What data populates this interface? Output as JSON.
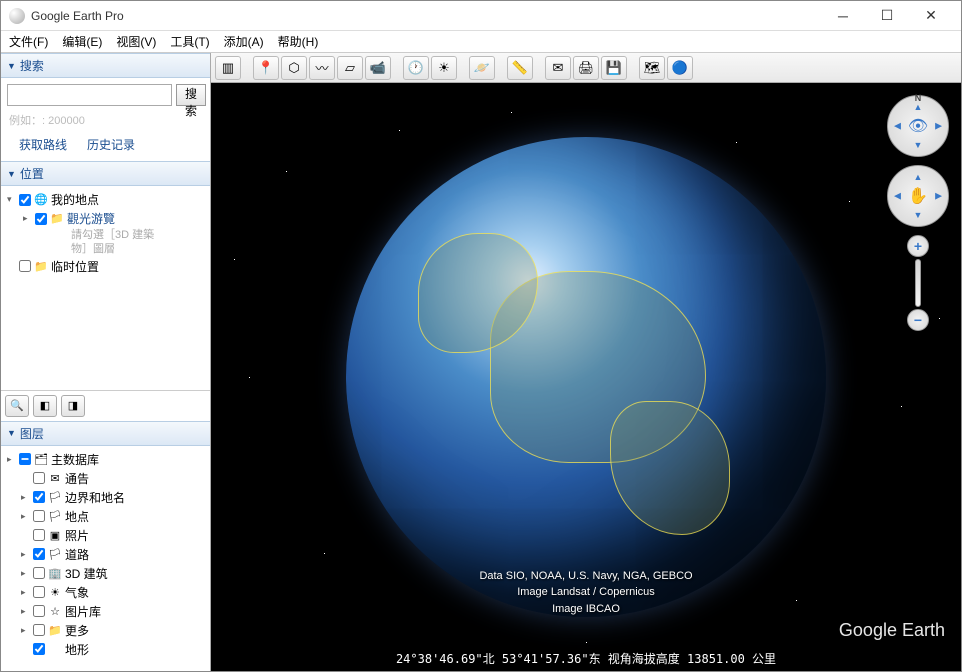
{
  "window": {
    "title": "Google Earth Pro"
  },
  "menu": {
    "file": "文件(F)",
    "edit": "编辑(E)",
    "view": "视图(V)",
    "tools": "工具(T)",
    "add": "添加(A)",
    "help": "帮助(H)"
  },
  "search": {
    "header": "搜索",
    "button": "搜索",
    "placeholder": "",
    "hint": "例如：: 200000",
    "directions": "获取路线",
    "history": "历史记录"
  },
  "places": {
    "header": "位置",
    "my_places": "我的地点",
    "tour": "觀光游覽",
    "tour_hint1": "請勾選［3D 建築",
    "tour_hint2": "物］圖層",
    "temp": "临时位置"
  },
  "layers": {
    "header": "图层",
    "items": [
      {
        "label": "主数据库",
        "icon": "🗂",
        "checked": "mixed",
        "expand": true
      },
      {
        "label": "通告",
        "icon": "✉",
        "checked": false,
        "indent": 1
      },
      {
        "label": "边界和地名",
        "icon": "🏳",
        "checked": true,
        "expand": true,
        "indent": 1
      },
      {
        "label": "地点",
        "icon": "🏳",
        "checked": false,
        "expand": true,
        "indent": 1
      },
      {
        "label": "照片",
        "icon": "▣",
        "checked": false,
        "indent": 1
      },
      {
        "label": "道路",
        "icon": "🏳",
        "checked": true,
        "expand": true,
        "indent": 1
      },
      {
        "label": "3D 建筑",
        "icon": "🏢",
        "checked": false,
        "expand": true,
        "indent": 1
      },
      {
        "label": "气象",
        "icon": "☀",
        "checked": false,
        "expand": true,
        "indent": 1
      },
      {
        "label": "图片库",
        "icon": "☆",
        "checked": false,
        "expand": true,
        "indent": 1
      },
      {
        "label": "更多",
        "icon": "📁",
        "checked": false,
        "expand": true,
        "indent": 1
      },
      {
        "label": "地形",
        "icon": "",
        "checked": true,
        "indent": 1
      }
    ]
  },
  "attribution": {
    "line1": "Data SIO, NOAA, U.S. Navy, NGA, GEBCO",
    "line2": "Image Landsat / Copernicus",
    "line3": "Image IBCAO"
  },
  "watermark": "Google Earth",
  "status": "24°38'46.69\"北   53°41'57.36\"东  视角海拔高度 13851.00 公里"
}
